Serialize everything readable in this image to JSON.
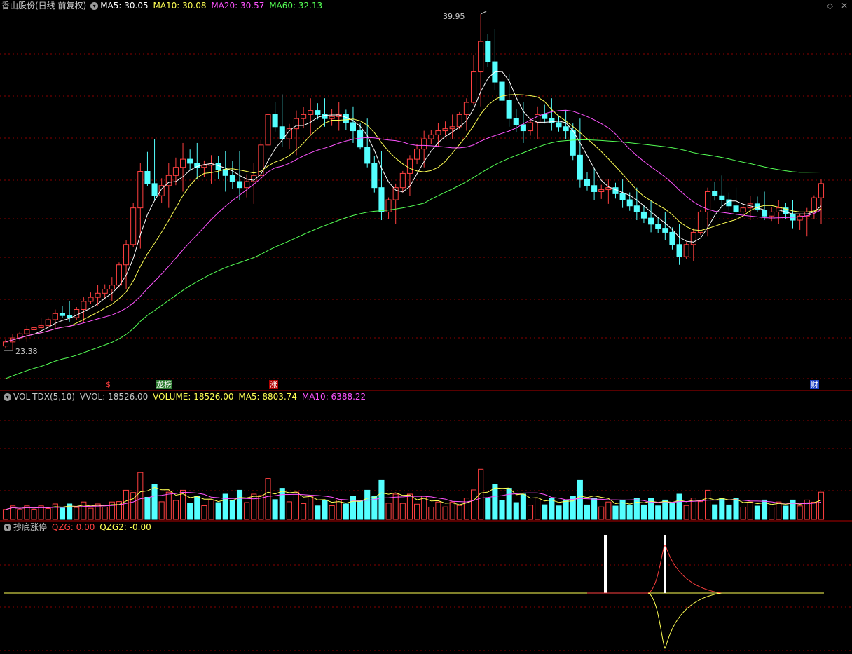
{
  "colors": {
    "up": "#ff4040",
    "down": "#54ffff",
    "ma5": "#ffffff",
    "ma10": "#ffff54",
    "ma20": "#ff54ff",
    "ma60": "#54ff54",
    "grid": "#8a0000",
    "label": "#c8c8c8"
  },
  "header": {
    "stock": "香山股份(日线 前复权)",
    "ma5": "MA5: 30.05",
    "ma10": "MA10: 30.08",
    "ma20": "MA20: 30.57",
    "ma60": "MA60: 32.13"
  },
  "volume_header": {
    "name": "VOL-TDX(5,10)",
    "vvol": "VVOL: 18526.00",
    "volume": "VOLUME: 18526.00",
    "ma5": "MA5: 8803.74",
    "ma10": "MA10: 6388.22"
  },
  "indicator_header": {
    "name": "抄底涨停",
    "qzg": "QZG: 0.00",
    "qzg2": "QZG2: -0.00"
  },
  "markers": {
    "high": "39.95",
    "low": "23.38",
    "s": "$",
    "zt": "涨",
    "lhb": "龙榜",
    "cai": "财"
  },
  "icons": [
    "collapse-chevron-icon",
    "diamond-icon",
    "close-icon"
  ],
  "chart_data": {
    "type": "candlestick",
    "period": "daily",
    "price_high": 39.95,
    "price_low": 23.38,
    "ohlc_sampled_every_2_sessions": [
      [
        23.6,
        24.2,
        23.4,
        24.0
      ],
      [
        24.0,
        24.6,
        23.8,
        24.4
      ],
      [
        24.4,
        25.0,
        24.2,
        24.6
      ],
      [
        24.6,
        25.4,
        24.4,
        25.2
      ],
      [
        25.2,
        25.8,
        24.8,
        25.0
      ],
      [
        25.0,
        26.0,
        24.8,
        25.8
      ],
      [
        25.8,
        26.6,
        25.6,
        26.2
      ],
      [
        26.2,
        27.0,
        25.8,
        26.6
      ],
      [
        26.6,
        28.8,
        26.4,
        28.6
      ],
      [
        28.6,
        32.6,
        28.4,
        32.2
      ],
      [
        32.2,
        33.8,
        30.8,
        31.0
      ],
      [
        31.0,
        32.6,
        30.4,
        32.0
      ],
      [
        32.0,
        33.6,
        31.2,
        32.8
      ],
      [
        32.8,
        33.6,
        31.8,
        32.4
      ],
      [
        32.4,
        33.0,
        31.6,
        32.6
      ],
      [
        32.6,
        33.2,
        31.2,
        32.0
      ],
      [
        32.0,
        33.2,
        30.8,
        31.4
      ],
      [
        31.4,
        32.6,
        30.6,
        32.0
      ],
      [
        32.0,
        35.4,
        31.8,
        35.0
      ],
      [
        35.0,
        36.0,
        33.4,
        33.8
      ],
      [
        33.8,
        35.2,
        33.0,
        34.8
      ],
      [
        34.8,
        35.8,
        34.0,
        35.2
      ],
      [
        35.2,
        35.8,
        34.4,
        34.8
      ],
      [
        34.8,
        35.6,
        34.2,
        35.0
      ],
      [
        35.0,
        35.4,
        33.6,
        34.2
      ],
      [
        34.2,
        34.8,
        32.4,
        32.6
      ],
      [
        32.6,
        33.2,
        29.8,
        30.2
      ],
      [
        30.2,
        31.6,
        29.6,
        31.4
      ],
      [
        31.4,
        33.0,
        31.0,
        32.8
      ],
      [
        32.8,
        34.2,
        32.4,
        33.8
      ],
      [
        33.8,
        34.6,
        33.4,
        34.2
      ],
      [
        34.2,
        35.0,
        33.8,
        34.4
      ],
      [
        34.4,
        35.8,
        34.2,
        35.6
      ],
      [
        35.6,
        39.95,
        35.4,
        38.6
      ],
      [
        38.6,
        39.2,
        36.2,
        36.6
      ],
      [
        36.6,
        37.0,
        34.4,
        34.8
      ],
      [
        34.8,
        35.6,
        33.6,
        34.2
      ],
      [
        34.2,
        35.4,
        33.8,
        35.0
      ],
      [
        35.0,
        35.8,
        34.2,
        34.6
      ],
      [
        34.6,
        35.2,
        33.8,
        34.2
      ],
      [
        34.2,
        34.8,
        31.4,
        31.8
      ],
      [
        31.8,
        32.4,
        30.8,
        31.2
      ],
      [
        31.2,
        31.8,
        30.6,
        31.4
      ],
      [
        31.4,
        31.8,
        30.4,
        30.8
      ],
      [
        30.8,
        31.4,
        29.8,
        30.2
      ],
      [
        30.2,
        30.8,
        29.2,
        29.6
      ],
      [
        29.6,
        30.2,
        28.8,
        29.2
      ],
      [
        29.2,
        29.6,
        27.6,
        28.0
      ],
      [
        28.0,
        29.4,
        27.8,
        29.2
      ],
      [
        29.2,
        31.4,
        29.0,
        31.2
      ],
      [
        31.2,
        32.0,
        30.4,
        30.8
      ],
      [
        30.8,
        31.4,
        29.8,
        30.2
      ],
      [
        30.2,
        31.0,
        29.8,
        30.6
      ],
      [
        30.6,
        31.2,
        29.8,
        30.0
      ],
      [
        30.0,
        30.8,
        29.6,
        30.4
      ],
      [
        30.4,
        30.8,
        29.4,
        29.8
      ],
      [
        29.8,
        30.4,
        29.0,
        30.2
      ],
      [
        30.2,
        31.8,
        29.6,
        31.6
      ]
    ],
    "indicator_QZG_signals": [
      "spike",
      "spike"
    ]
  }
}
